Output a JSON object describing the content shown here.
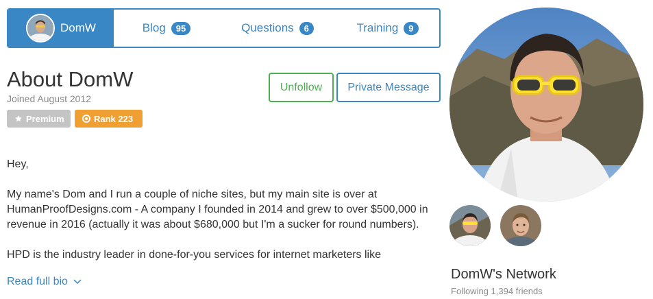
{
  "tabs": {
    "profile": {
      "label": "DomW"
    },
    "blog": {
      "label": "Blog",
      "count": "95"
    },
    "questions": {
      "label": "Questions",
      "count": "6"
    },
    "training": {
      "label": "Training",
      "count": "9"
    }
  },
  "profile": {
    "title": "About DomW",
    "joined": "Joined August 2012",
    "badges": {
      "premium": "Premium",
      "rank": "Rank 223"
    }
  },
  "actions": {
    "unfollow": "Unfollow",
    "private_message": "Private Message"
  },
  "bio": {
    "greeting": "Hey,",
    "paragraph1": "My name's Dom and I run a couple of niche sites, but my main site is over at HumanProofDesigns.com - A company I founded in 2014 and grew to over $500,000 in revenue in 2016 (actually it was about $680,000 but I'm a sucker for round numbers).",
    "paragraph2": "HPD is the industry leader in done-for-you services for internet marketers like",
    "read_more": "Read full bio"
  },
  "network": {
    "title": "DomW's Network",
    "following": "Following 1,394 friends"
  },
  "colors": {
    "accent": "#3a87c5",
    "success": "#4caf50",
    "rank": "#f0a032",
    "premium": "#c4c4c4"
  },
  "icons": {
    "premium": "star-icon",
    "rank": "target-icon",
    "read_more": "chevron-down-icon"
  }
}
